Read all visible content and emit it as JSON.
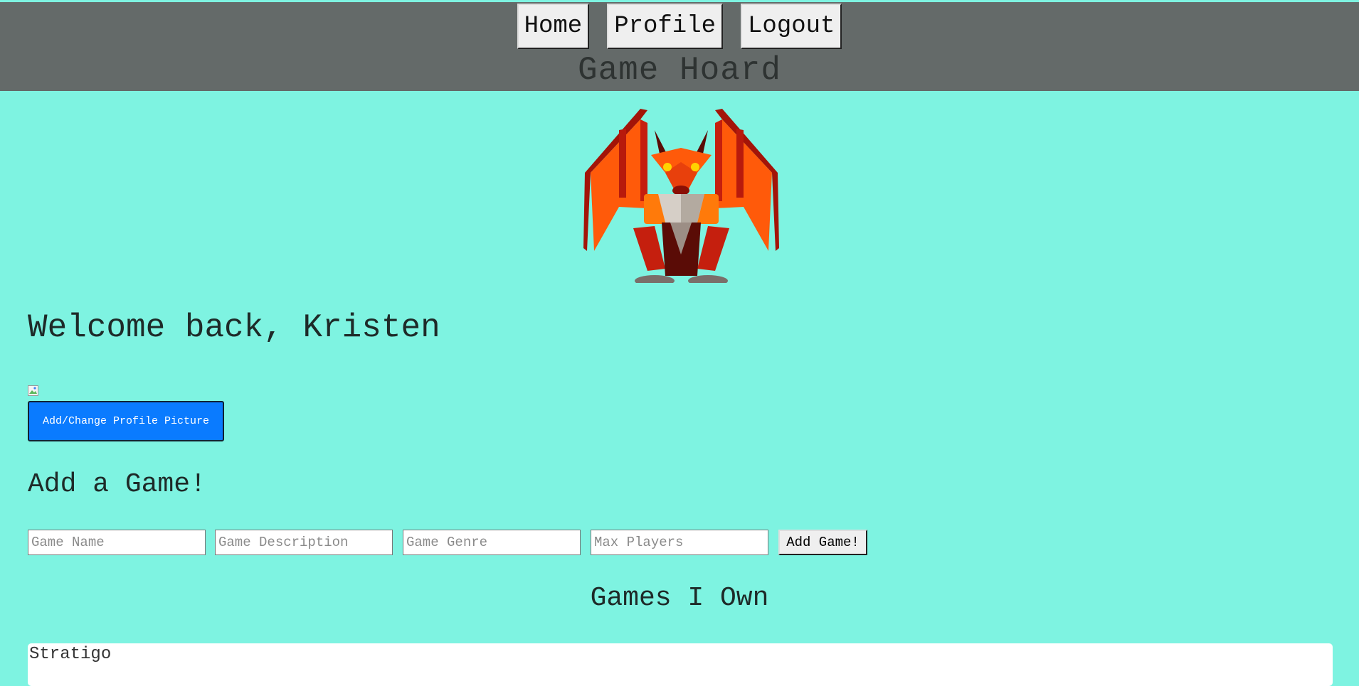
{
  "nav": {
    "items": [
      {
        "label": "Home"
      },
      {
        "label": "Profile"
      },
      {
        "label": "Logout"
      }
    ]
  },
  "site": {
    "title": "Game Hoard",
    "logo_icon": "dragon-logo-icon"
  },
  "welcome": {
    "text": "Welcome back, Kristen"
  },
  "profile": {
    "picture_button_label": "Add/Change Profile Picture"
  },
  "add_game": {
    "heading": "Add a Game!",
    "fields": {
      "name_placeholder": "Game Name",
      "description_placeholder": "Game Description",
      "genre_placeholder": "Game Genre",
      "players_placeholder": "Max Players"
    },
    "submit_label": "Add Game!"
  },
  "owned": {
    "heading": "Games I Own",
    "games": [
      {
        "name": "Stratigo"
      }
    ]
  },
  "colors": {
    "background": "#7ef3e1",
    "header": "#646a69",
    "primary_button": "#0a7bff"
  }
}
